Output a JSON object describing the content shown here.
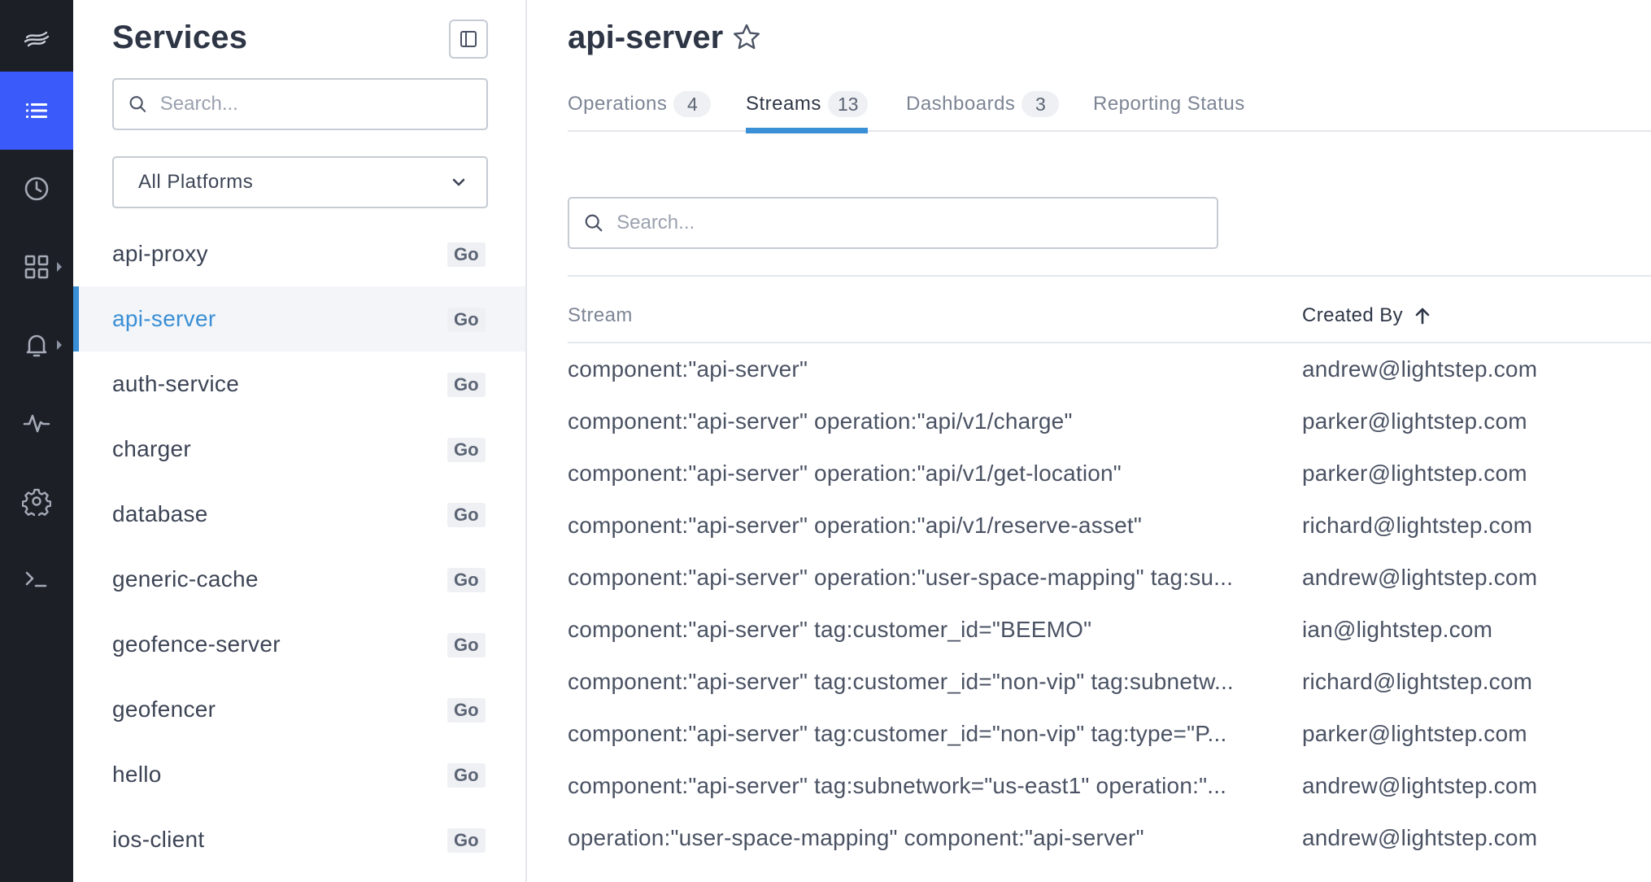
{
  "nav": {
    "items": [
      {
        "name": "logo",
        "icon": "lightstep-logo-icon"
      },
      {
        "name": "services",
        "icon": "list-icon",
        "active": true
      },
      {
        "name": "history",
        "icon": "clock-icon"
      },
      {
        "name": "dashboards",
        "icon": "grid-icon",
        "submenu": true
      },
      {
        "name": "alerts",
        "icon": "bell-icon",
        "submenu": true
      },
      {
        "name": "activity",
        "icon": "pulse-icon"
      },
      {
        "name": "settings",
        "icon": "gear-icon"
      },
      {
        "name": "terminal",
        "icon": "terminal-icon"
      }
    ],
    "active_color": "#3a5afa"
  },
  "sidebar": {
    "title": "Services",
    "search_placeholder": "Search...",
    "platform_select": "All Platforms",
    "services": [
      {
        "name": "api-proxy",
        "lang": "Go"
      },
      {
        "name": "api-server",
        "lang": "Go",
        "active": true
      },
      {
        "name": "auth-service",
        "lang": "Go"
      },
      {
        "name": "charger",
        "lang": "Go"
      },
      {
        "name": "database",
        "lang": "Go"
      },
      {
        "name": "generic-cache",
        "lang": "Go"
      },
      {
        "name": "geofence-server",
        "lang": "Go"
      },
      {
        "name": "geofencer",
        "lang": "Go"
      },
      {
        "name": "hello",
        "lang": "Go"
      },
      {
        "name": "ios-client",
        "lang": "Go"
      }
    ]
  },
  "main": {
    "title": "api-server",
    "tabs": [
      {
        "label": "Operations",
        "count": "4"
      },
      {
        "label": "Streams",
        "count": "13",
        "active": true
      },
      {
        "label": "Dashboards",
        "count": "3"
      },
      {
        "label": "Reporting Status",
        "count": ""
      }
    ],
    "search_placeholder": "Search...",
    "table": {
      "headers": {
        "stream": "Stream",
        "created_by": "Created By"
      },
      "sort": "ascending",
      "rows": [
        {
          "stream": "component:\"api-server\"",
          "created_by": "andrew@lightstep.com"
        },
        {
          "stream": "component:\"api-server\" operation:\"api/v1/charge\"",
          "created_by": "parker@lightstep.com"
        },
        {
          "stream": "component:\"api-server\" operation:\"api/v1/get-location\"",
          "created_by": "parker@lightstep.com"
        },
        {
          "stream": "component:\"api-server\" operation:\"api/v1/reserve-asset\"",
          "created_by": "richard@lightstep.com"
        },
        {
          "stream": "component:\"api-server\" operation:\"user-space-mapping\" tag:su...",
          "created_by": "andrew@lightstep.com"
        },
        {
          "stream": "component:\"api-server\" tag:customer_id=\"BEEMO\"",
          "created_by": "ian@lightstep.com"
        },
        {
          "stream": "component:\"api-server\" tag:customer_id=\"non-vip\" tag:subnetw...",
          "created_by": "richard@lightstep.com"
        },
        {
          "stream": "component:\"api-server\" tag:customer_id=\"non-vip\" tag:type=\"P...",
          "created_by": "parker@lightstep.com"
        },
        {
          "stream": "component:\"api-server\" tag:subnetwork=\"us-east1\" operation:\"...",
          "created_by": "andrew@lightstep.com"
        },
        {
          "stream": "operation:\"user-space-mapping\" component:\"api-server\"",
          "created_by": "andrew@lightstep.com"
        }
      ]
    },
    "accent_color": "#3a8fd6"
  }
}
